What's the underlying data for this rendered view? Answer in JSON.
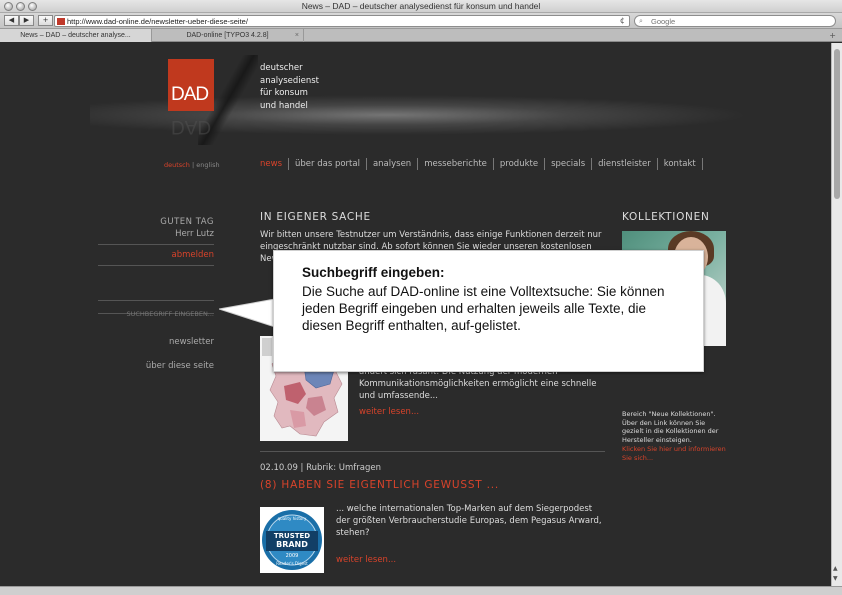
{
  "window": {
    "title": "News – DAD – deutscher analysedienst für konsum und handel"
  },
  "toolbar": {
    "back": "◀",
    "forward": "▶",
    "add": "+",
    "url": "http://www.dad-online.de/newsletter-ueber-diese-seite/",
    "reload": "¢",
    "search_placeholder": "Google"
  },
  "tabs": [
    {
      "label": "News – DAD – deutscher analyse...",
      "active": true
    },
    {
      "label": "DAD-online [TYPO3 4.2.8]",
      "active": false
    }
  ],
  "site": {
    "logo_text": "DAD",
    "tagline": [
      "deutscher",
      "analysedienst",
      "für konsum",
      "und handel"
    ],
    "lang": {
      "de": "deutsch",
      "sep": "|",
      "en": "english"
    },
    "nav": [
      {
        "label": "news",
        "active": true
      },
      {
        "label": "über das portal",
        "active": false
      },
      {
        "label": "analysen",
        "active": false
      },
      {
        "label": "messeberichte",
        "active": false
      },
      {
        "label": "produkte",
        "active": false
      },
      {
        "label": "specials",
        "active": false
      },
      {
        "label": "dienstleister",
        "active": false
      },
      {
        "label": "kontakt",
        "active": false
      }
    ]
  },
  "sidebar": {
    "greeting": "GUTEN TAG",
    "user": "Herr Lutz",
    "logout": "abmelden",
    "search_placeholder": "SUCHBEGRIFF EINGEBEN...",
    "newsletter": "newsletter",
    "about": "über diese seite"
  },
  "main": {
    "section_title": "IN EIGENER SACHE",
    "intro": "Wir bitten unsere Testnutzer um Verständnis, dass einige Funktionen derzeit nur eingeschränkt nutzbar sind. Ab sofort können Sie wieder unseren kostenlosen Newsletter abonnieren. Sei",
    "article1": {
      "text": "ändert sich rasant: Die Nutzung der modernen Kommunikationsmöglichkeiten ermöglicht eine schnelle und umfassende...",
      "more": "weiter lesen..."
    },
    "article2": {
      "meta": "02.10.09 | Rubrik: Umfragen",
      "title": "(8) HABEN SIE EIGENTLICH GEWUSST ...",
      "text": "... welche internationalen Top-Marken auf dem Siegerpodest der größten Verbraucherstudie Europas, dem Pegasus Arward, stehen?",
      "more": "weiter lesen...",
      "badge": {
        "top": "quality history",
        "line1": "TRUSTED",
        "line2": "BRAND",
        "year": "2009",
        "bottom": "Reader's Digest"
      }
    }
  },
  "right": {
    "section_title": "KOLLEKTIONEN",
    "text": "Bereich \"Neue Kollektionen\". Über den Link können Sie gezielt in die Kollektionen der Hersteller einsteigen.",
    "link": "Klicken Sie hier und informieren Sie sich..."
  },
  "callout": {
    "title": "Suchbegriff eingeben:",
    "body": "Die Suche auf DAD-online ist eine Volltextsuche: Sie können jeden Begriff eingeben und erhalten jeweils alle Texte, die diesen Begriff enthalten, auf-gelistet."
  },
  "colors": {
    "accent": "#d8432b",
    "page_bg": "#2b2b2b",
    "logo_bg": "#c0391e"
  }
}
